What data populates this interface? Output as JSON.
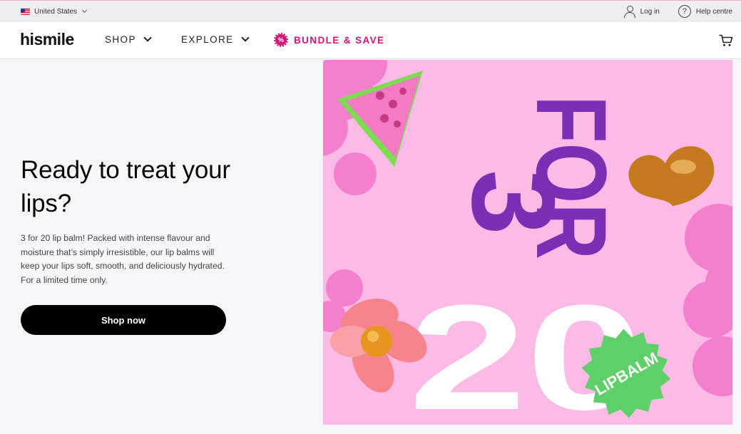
{
  "topbar": {
    "country": "United States",
    "login": "Log in",
    "help": "Help centre"
  },
  "header": {
    "logo": "hismile",
    "nav": {
      "shop": "SHOP",
      "explore": "EXPLORE",
      "bundle": "BUNDLE & SAVE"
    }
  },
  "hero": {
    "title": "Ready to treat your lips?",
    "body": "3 for 20 lip balm! Packed with intense flavour and moisture that’s simply irresistible, our lip balms will keep your lips soft, smooth, and deliciously hydrated. For a limited time only.",
    "cta": "Shop now"
  },
  "promo": {
    "number_three": "3",
    "word_for": "FOR",
    "number_twenty": "20",
    "badge": "LIPBALM"
  },
  "colors": {
    "accent_pink": "#d2177a",
    "promo_bg": "#fbbbe6",
    "promo_purple": "#7b2fb5",
    "badge_green": "#5fcf68"
  }
}
